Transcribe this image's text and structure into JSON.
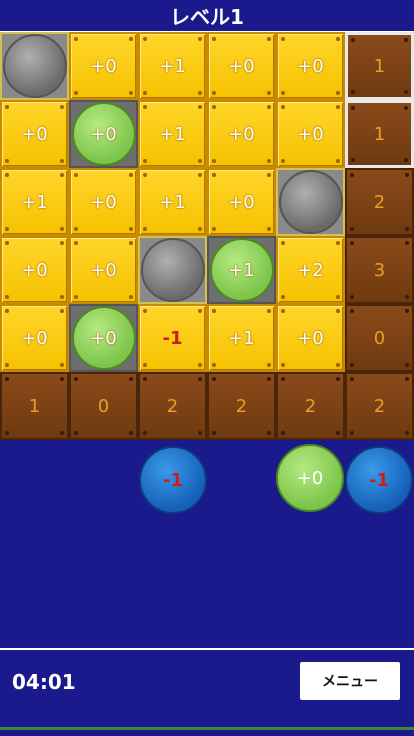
{
  "header": {
    "title": "レベル1"
  },
  "board": {
    "rows": [
      [
        {
          "type": "gray"
        },
        {
          "type": "yellow",
          "label": "+0"
        },
        {
          "type": "yellow",
          "label": "+1"
        },
        {
          "type": "yellow",
          "label": "+0"
        },
        {
          "type": "yellow",
          "label": "+0"
        },
        {
          "type": "brown",
          "label": "1",
          "highlight": true
        }
      ],
      [
        {
          "type": "yellow",
          "label": "+0"
        },
        {
          "type": "green",
          "label": "+0"
        },
        {
          "type": "yellow",
          "label": "+1"
        },
        {
          "type": "yellow",
          "label": "+0"
        },
        {
          "type": "yellow",
          "label": "+0"
        },
        {
          "type": "brown",
          "label": "1",
          "highlight": true
        }
      ],
      [
        {
          "type": "yellow",
          "label": "+1"
        },
        {
          "type": "yellow",
          "label": "+0"
        },
        {
          "type": "yellow",
          "label": "+1"
        },
        {
          "type": "yellow",
          "label": "+0"
        },
        {
          "type": "gray"
        },
        {
          "type": "brown",
          "label": "2"
        }
      ],
      [
        {
          "type": "yellow",
          "label": "+0"
        },
        {
          "type": "yellow",
          "label": "+0"
        },
        {
          "type": "gray"
        },
        {
          "type": "green",
          "label": "+1"
        },
        {
          "type": "yellow",
          "label": "+2"
        },
        {
          "type": "brown",
          "label": "3"
        }
      ],
      [
        {
          "type": "yellow",
          "label": "+0"
        },
        {
          "type": "green",
          "label": "+0"
        },
        {
          "type": "yellow",
          "label": "-1",
          "neg": true
        },
        {
          "type": "yellow",
          "label": "+1"
        },
        {
          "type": "yellow",
          "label": "+0"
        },
        {
          "type": "brown",
          "label": "0"
        }
      ],
      [
        {
          "type": "brown",
          "label": "1"
        },
        {
          "type": "brown",
          "label": "0"
        },
        {
          "type": "brown",
          "label": "2"
        },
        {
          "type": "brown",
          "label": "2"
        },
        {
          "type": "brown",
          "label": "2"
        },
        {
          "type": "brown",
          "label": "2"
        }
      ]
    ]
  },
  "tray": {
    "pieces": [
      {
        "color": "blue",
        "label": "-1",
        "neg": true
      },
      {
        "color": "green",
        "label": "+0"
      },
      {
        "color": "blue",
        "label": "-1",
        "neg": true
      }
    ]
  },
  "footer": {
    "timer": "04:01",
    "menu_label": "メニュー"
  },
  "colors": {
    "background": "#1a1a8c",
    "tile": "#f5c200",
    "target": "#6f3a10",
    "green": "#7cc44a",
    "blue": "#1560b8",
    "negative": "#c81e1e"
  }
}
